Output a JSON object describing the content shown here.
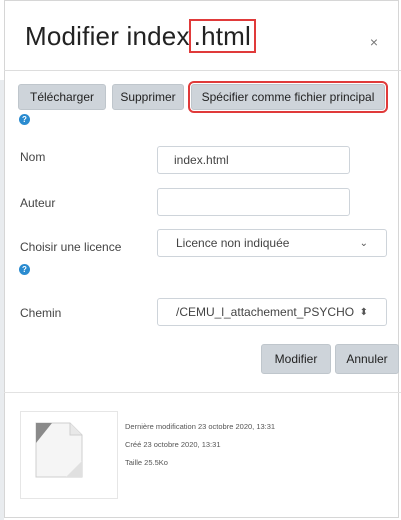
{
  "dialog": {
    "title_prefix": "Modifier index",
    "title_highlight": ".html",
    "close_label": "×"
  },
  "toolbar": {
    "upload_label": "Télécharger",
    "delete_label": "Supprimer",
    "main_label": "Spécifier comme fichier principal"
  },
  "form": {
    "name_label": "Nom",
    "name_value": "index.html",
    "author_label": "Auteur",
    "author_value": "",
    "license_label": "Choisir une licence",
    "license_value": "Licence non indiquée",
    "path_label": "Chemin",
    "path_value": "/CEMU_l_attachement_PSYCHO (Wel"
  },
  "actions": {
    "modify_label": "Modifier",
    "cancel_label": "Annuler"
  },
  "file_info": {
    "modified": "Dernière modification  23 octobre 2020, 13:31",
    "created": "Créé  23 octobre 2020, 13:31",
    "size": "Taille  25.5Ko"
  },
  "icons": {
    "help": "?",
    "select_arrow_down": "⌄",
    "select_arrow_updown": "⬍"
  },
  "colors": {
    "highlight": "#e03a3a",
    "help": "#2a8bd0",
    "button_bg": "#ced4da"
  }
}
